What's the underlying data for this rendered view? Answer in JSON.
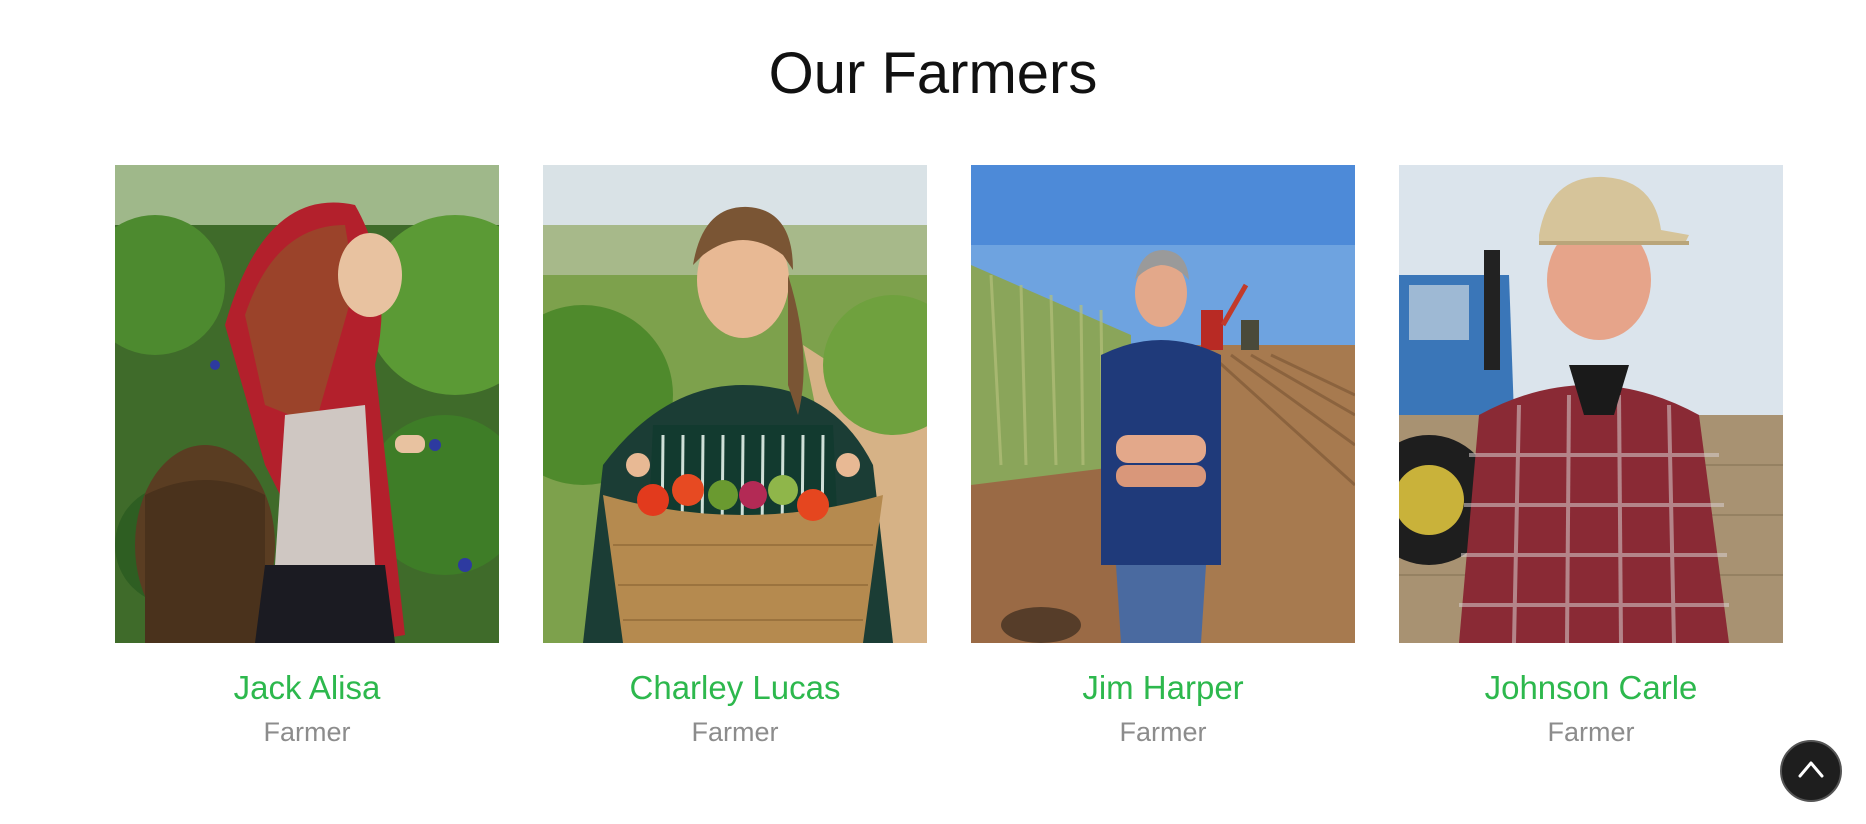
{
  "section": {
    "title": "Our Farmers"
  },
  "farmers": [
    {
      "name": "Jack Alisa",
      "role": "Farmer"
    },
    {
      "name": "Charley Lucas",
      "role": "Farmer"
    },
    {
      "name": "Jim Harper",
      "role": "Farmer"
    },
    {
      "name": "Johnson Carle",
      "role": "Farmer"
    }
  ],
  "colors": {
    "name": "#2db84d",
    "role": "#8c8c8c",
    "back_to_top_bg": "#1e1e1e"
  },
  "back_to_top": {
    "icon": "chevron-up-icon"
  }
}
